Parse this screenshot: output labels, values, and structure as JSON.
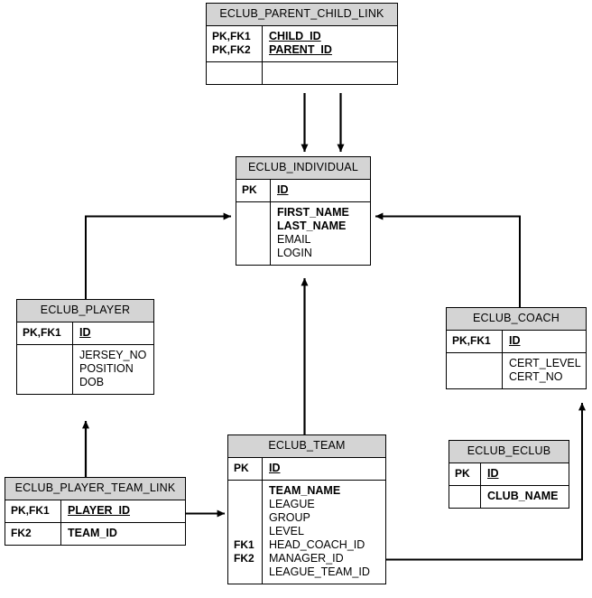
{
  "diagram": {
    "type": "entity-relationship-diagram",
    "background_color": "#ffffff",
    "header_fill": "#d4d4d4",
    "line_color": "#000000"
  },
  "entities": {
    "parent_child_link": {
      "name": "ECLUB_PARENT_CHILD_LINK",
      "keys": [
        "PK,FK1",
        "PK,FK2"
      ],
      "key_attributes": [
        "CHILD_ID",
        "PARENT_ID"
      ],
      "attributes": []
    },
    "individual": {
      "name": "ECLUB_INDIVIDUAL",
      "keys": [
        "PK"
      ],
      "key_attributes": [
        "ID"
      ],
      "attributes": [
        "FIRST_NAME",
        "LAST_NAME",
        "EMAIL",
        "LOGIN"
      ]
    },
    "player": {
      "name": "ECLUB_PLAYER",
      "keys": [
        "PK,FK1"
      ],
      "key_attributes": [
        "ID"
      ],
      "attributes": [
        "JERSEY_NO",
        "POSITION",
        "DOB"
      ]
    },
    "coach": {
      "name": "ECLUB_COACH",
      "keys": [
        "PK,FK1"
      ],
      "key_attributes": [
        "ID"
      ],
      "attributes": [
        "CERT_LEVEL",
        "CERT_NO"
      ]
    },
    "team": {
      "name": "ECLUB_TEAM",
      "keys": [
        "PK"
      ],
      "key_attributes": [
        "ID"
      ],
      "attributes": [
        "TEAM_NAME",
        "LEAGUE",
        "GROUP",
        "LEVEL",
        "HEAD_COACH_ID",
        "MANAGER_ID",
        "LEAGUE_TEAM_ID"
      ],
      "attribute_keys": [
        "",
        "",
        "",
        "",
        "FK1",
        "FK2",
        ""
      ]
    },
    "eclub": {
      "name": "ECLUB_ECLUB",
      "keys": [
        "PK"
      ],
      "key_attributes": [
        "ID"
      ],
      "attributes": [
        "CLUB_NAME"
      ]
    },
    "player_team_link": {
      "name": "ECLUB_PLAYER_TEAM_LINK",
      "keys": [
        "PK,FK1",
        "FK2"
      ],
      "key_attributes": [
        "PLAYER_ID"
      ],
      "attributes": [
        "TEAM_ID"
      ]
    }
  },
  "relationships": [
    {
      "from": "ECLUB_PARENT_CHILD_LINK",
      "to": "ECLUB_INDIVIDUAL",
      "label": "CHILD_ID"
    },
    {
      "from": "ECLUB_PARENT_CHILD_LINK",
      "to": "ECLUB_INDIVIDUAL",
      "label": "PARENT_ID"
    },
    {
      "from": "ECLUB_PLAYER",
      "to": "ECLUB_INDIVIDUAL",
      "label": "ID"
    },
    {
      "from": "ECLUB_COACH",
      "to": "ECLUB_INDIVIDUAL",
      "label": "ID"
    },
    {
      "from": "ECLUB_TEAM",
      "to": "ECLUB_INDIVIDUAL",
      "label": "MANAGER_ID"
    },
    {
      "from": "ECLUB_PLAYER_TEAM_LINK",
      "to": "ECLUB_PLAYER",
      "label": "PLAYER_ID"
    },
    {
      "from": "ECLUB_PLAYER_TEAM_LINK",
      "to": "ECLUB_TEAM",
      "label": "TEAM_ID"
    },
    {
      "from": "ECLUB_TEAM",
      "to": "ECLUB_COACH",
      "label": "HEAD_COACH_ID"
    }
  ]
}
